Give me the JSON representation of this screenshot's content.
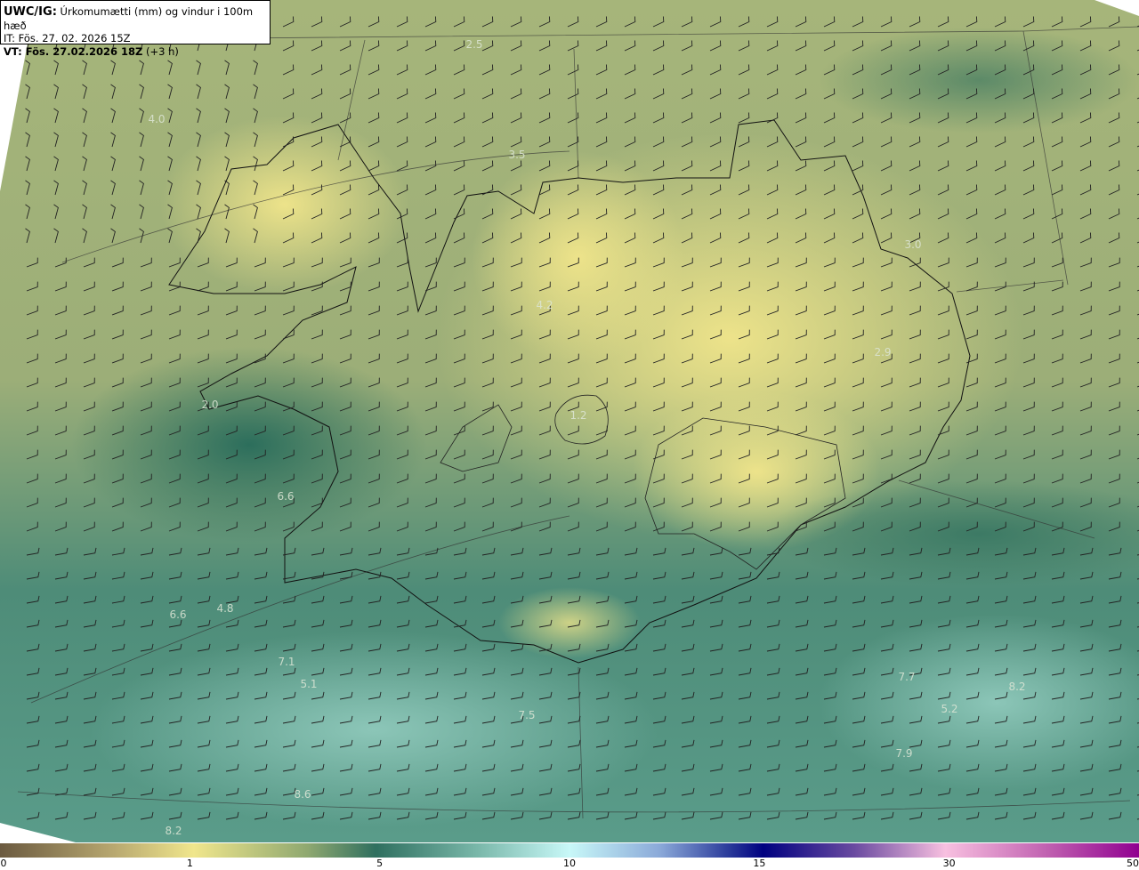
{
  "header": {
    "product": "UWC/IG:",
    "description": "Úrkomumætti (mm) og vindur i 100m hæð",
    "issue_time": "IT: Fös. 27. 02. 2026 15Z",
    "valid_time_label": "VT: Fös. 27.02.2026 18Z",
    "lead_time": "(+3 h)"
  },
  "map": {
    "field": "precipitable water",
    "overlay": "wind barbs",
    "value_labels": [
      "2.5",
      "4.0",
      "3.5",
      "3.0",
      "4.2",
      "2.9",
      "2.0",
      "1.2",
      "6.6",
      "6.6",
      "4.8",
      "7.1",
      "5.1",
      "7.5",
      "7.7",
      "8.2",
      "5.2",
      "7.9",
      "8.6",
      "8.2"
    ]
  },
  "colorbar": {
    "ticks": [
      "0",
      "1",
      "5",
      "10",
      "15",
      "30",
      "50"
    ],
    "colors": [
      "#6b5a40",
      "#f0e68c",
      "#2f6f5f",
      "#c8f8f8",
      "#000080",
      "#f8c0e0",
      "#900090"
    ]
  }
}
